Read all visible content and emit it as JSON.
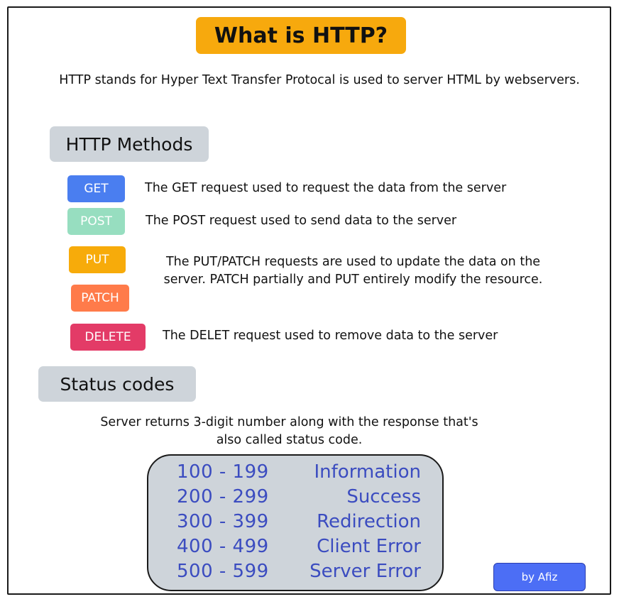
{
  "title": "What is HTTP?",
  "intro": "HTTP stands for Hyper Text Transfer Protocal is used to server HTML by webservers.",
  "methods_heading": "HTTP Methods",
  "methods": [
    {
      "label": "GET",
      "color": "#4a7ef0",
      "text": "The GET request used to request the data from the server"
    },
    {
      "label": "POST",
      "color": "#97dec0",
      "text": "The POST request used to send data to the server"
    },
    {
      "label": "PUT",
      "color": "#f7ab0a"
    },
    {
      "label": "PATCH",
      "color": "#ff7b4a"
    },
    {
      "label": "DELETE",
      "color": "#e33b67",
      "text": "The DELET request used to remove data to the server"
    }
  ],
  "put_patch_text": "The PUT/PATCH requests are used to update the data on the server. PATCH partially and PUT entirely modify the resource.",
  "status_heading": "Status codes",
  "status_intro": "Server returns 3-digit number along with the response that's also called status code.",
  "status_codes": [
    {
      "range": "100 - 199",
      "label": "Information"
    },
    {
      "range": "200 - 299",
      "label": "Success"
    },
    {
      "range": "300 - 399",
      "label": "Redirection"
    },
    {
      "range": "400 - 499",
      "label": "Client Error"
    },
    {
      "range": "500 - 599",
      "label": "Server Error"
    }
  ],
  "author": "by Afiz",
  "colors": {
    "title_bg": "#f7a90d",
    "section_bg": "#ced4da",
    "status_text": "#3b4cc0",
    "author_bg": "#4c6ef5"
  }
}
